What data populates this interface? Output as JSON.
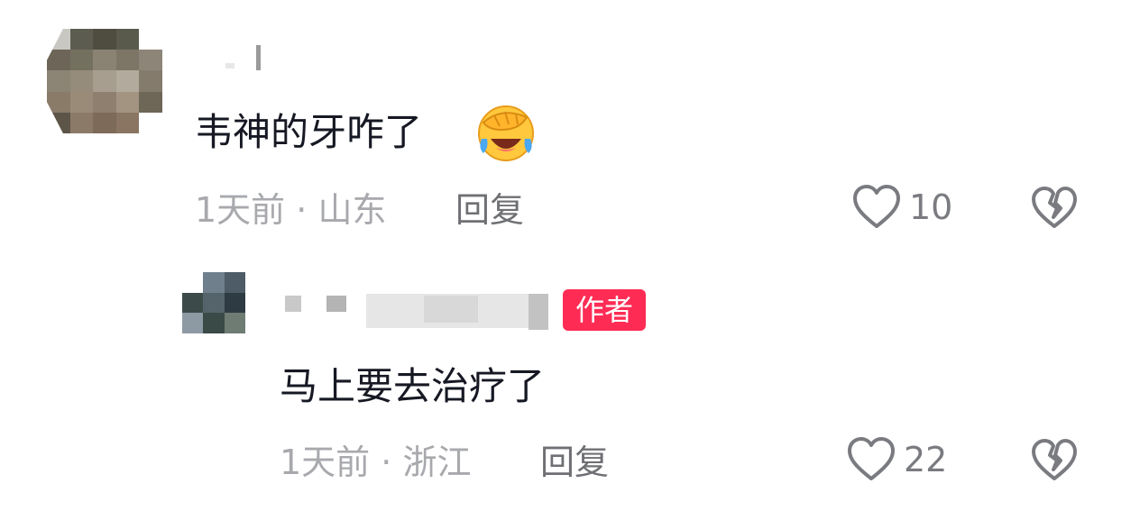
{
  "comments": [
    {
      "text": "韦神的牙咋了",
      "emoji": "face-with-tears-of-joy-covering-eyes",
      "time": "1天前",
      "separator": "·",
      "location": "山东",
      "reply_label": "回复",
      "likes": "10"
    },
    {
      "is_author": true,
      "author_badge": "作者",
      "text": "马上要去治疗了",
      "time": "1天前",
      "separator": "·",
      "location": "浙江",
      "reply_label": "回复",
      "likes": "22"
    }
  ],
  "colors": {
    "badge_bg": "#fe2c55",
    "text_primary": "#161823",
    "text_meta": "#a8a9ad",
    "icon": "#7a7b80"
  },
  "icons": {
    "like": "heart-outline-icon",
    "dislike": "broken-heart-icon"
  }
}
